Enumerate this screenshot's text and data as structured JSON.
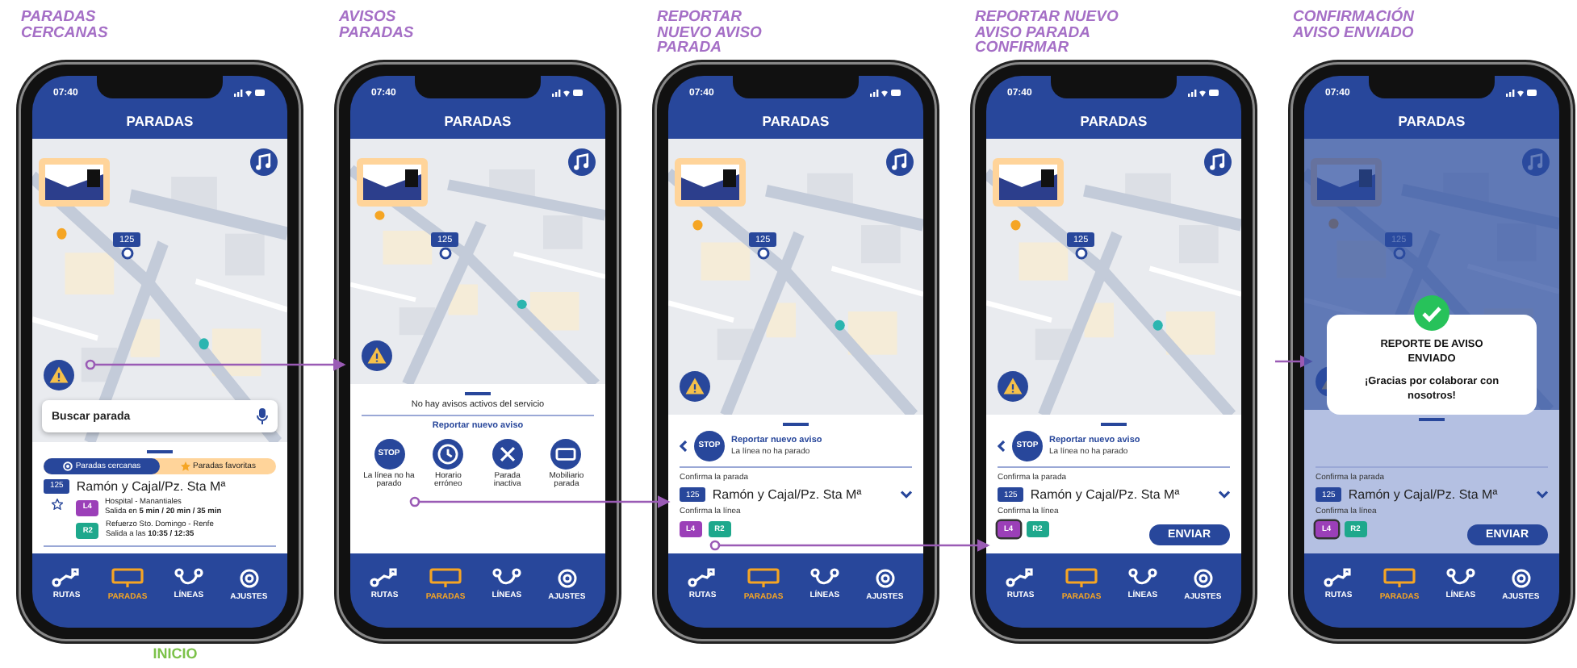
{
  "screens": [
    {
      "title_lines": [
        "PARADAS",
        "CERCANAS"
      ],
      "caption": "INICIO",
      "status_time": "07:40",
      "header": "PARADAS",
      "stop_marker": "125",
      "dimmed": false,
      "search": {
        "placeholder": "Buscar parada"
      },
      "panel": {
        "kind": "nearby",
        "tabs": [
          {
            "label": "Paradas cercanas",
            "selected": true
          },
          {
            "label": "Paradas favoritas",
            "selected": false
          }
        ],
        "stop": {
          "code": "125",
          "name": "Ramón y Cajal/Pz. Sta Mª",
          "favorite": false
        },
        "lines": [
          {
            "code": "L4",
            "color": "#9b3fb8",
            "destination": "Hospital - Manantiales",
            "schedule": "Salida en **5 min / 20 min / 35 min**"
          },
          {
            "code": "R2",
            "color": "#1ea88c",
            "destination": "Refuerzo Sto. Domingo - Renfe",
            "schedule": "Salida a las **10:35 / 12:35**"
          }
        ]
      },
      "nav": [
        {
          "label": "RUTAS",
          "selected": false
        },
        {
          "label": "PARADAS",
          "selected": true
        },
        {
          "label": "LÍNEAS",
          "selected": false
        },
        {
          "label": "AJUSTES",
          "selected": false
        }
      ]
    },
    {
      "title_lines": [
        "AVISOS",
        "PARADAS"
      ],
      "status_time": "07:40",
      "header": "PARADAS",
      "stop_marker": "125",
      "dimmed": false,
      "panel": {
        "kind": "alerts",
        "message": "No hay avisos activos del servicio",
        "link": "Reportar nuevo aviso",
        "options": [
          {
            "icon_text": "STOP",
            "label": "La línea no ha parado"
          },
          {
            "label": "Horario erróneo"
          },
          {
            "label": "Parada inactiva"
          },
          {
            "label": "Mobiliario parada"
          }
        ]
      },
      "nav": [
        {
          "label": "RUTAS",
          "selected": false
        },
        {
          "label": "PARADAS",
          "selected": true
        },
        {
          "label": "LÍNEAS",
          "selected": false
        },
        {
          "label": "AJUSTES",
          "selected": false
        }
      ]
    },
    {
      "title_lines": [
        "REPORTAR",
        "NUEVO AVISO",
        "PARADA"
      ],
      "status_time": "07:40",
      "header": "PARADAS",
      "stop_marker": "125",
      "dimmed": false,
      "panel": {
        "kind": "report",
        "icon_text": "STOP",
        "heading": "Reportar nuevo aviso",
        "subheading": "La línea no ha parado",
        "stop_label": "Confirma la parada",
        "stop": {
          "code": "125",
          "name": "Ramón y Cajal/Pz. Sta Mª"
        },
        "line_label": "Confirma la línea",
        "lines": [
          {
            "code": "L4",
            "color": "#9b3fb8",
            "selected": false
          },
          {
            "code": "R2",
            "color": "#1ea88c",
            "selected": false
          }
        ]
      },
      "nav": [
        {
          "label": "RUTAS",
          "selected": false
        },
        {
          "label": "PARADAS",
          "selected": true
        },
        {
          "label": "LÍNEAS",
          "selected": false
        },
        {
          "label": "AJUSTES",
          "selected": false
        }
      ]
    },
    {
      "title_lines": [
        "REPORTAR NUEVO",
        "AVISO PARADA",
        "CONFIRMAR"
      ],
      "status_time": "07:40",
      "header": "PARADAS",
      "stop_marker": "125",
      "dimmed": false,
      "panel": {
        "kind": "report",
        "icon_text": "STOP",
        "heading": "Reportar nuevo aviso",
        "subheading": "La línea no ha parado",
        "stop_label": "Confirma la parada",
        "stop": {
          "code": "125",
          "name": "Ramón y Cajal/Pz. Sta Mª"
        },
        "line_label": "Confirma la línea",
        "lines": [
          {
            "code": "L4",
            "color": "#9b3fb8",
            "selected": true
          },
          {
            "code": "R2",
            "color": "#1ea88c",
            "selected": false
          }
        ],
        "send_button": "ENVIAR"
      },
      "nav": [
        {
          "label": "RUTAS",
          "selected": false
        },
        {
          "label": "PARADAS",
          "selected": true
        },
        {
          "label": "LÍNEAS",
          "selected": false
        },
        {
          "label": "AJUSTES",
          "selected": false
        }
      ]
    },
    {
      "title_lines": [
        "CONFIRMACIÓN",
        "AVISO ENVIADO"
      ],
      "status_time": "07:40",
      "header": "PARADAS",
      "stop_marker": "125",
      "dimmed": true,
      "panel": {
        "kind": "report",
        "stop_label": "Confirma la parada",
        "stop": {
          "code": "125",
          "name": "Ramón y Cajal/Pz. Sta Mª"
        },
        "line_label": "Confirma la línea",
        "lines": [
          {
            "code": "L4",
            "color": "#9b3fb8",
            "selected": true
          },
          {
            "code": "R2",
            "color": "#1ea88c",
            "selected": false
          }
        ],
        "send_button": "ENVIAR"
      },
      "modal": {
        "title": "REPORTE DE AVISO ENVIADO",
        "message": "¡Gracias por colaborar con nosotros!"
      },
      "nav": [
        {
          "label": "RUTAS",
          "selected": false
        },
        {
          "label": "PARADAS",
          "selected": true
        },
        {
          "label": "LÍNEAS",
          "selected": false
        },
        {
          "label": "AJUSTES",
          "selected": false
        }
      ]
    }
  ]
}
